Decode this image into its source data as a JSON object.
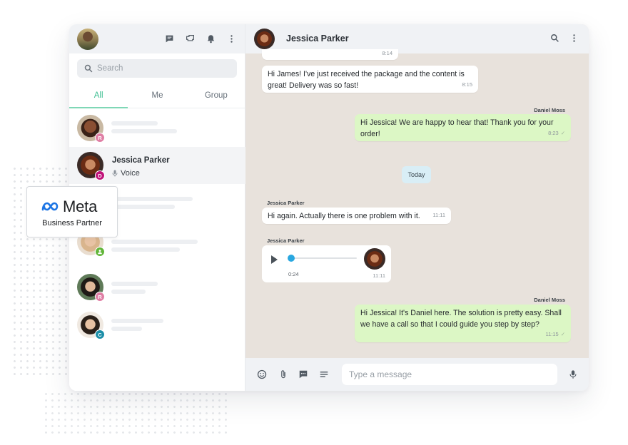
{
  "sidebar": {
    "header": {
      "icons": [
        "new-chat-icon",
        "broadcast-icon",
        "bell-icon",
        "more-vertical-icon"
      ]
    },
    "search": {
      "placeholder": "Search"
    },
    "tabs": [
      {
        "label": "All",
        "active": true
      },
      {
        "label": "Me"
      },
      {
        "label": "Group"
      }
    ],
    "chats": [
      {
        "badge": "R",
        "badge_color": "#e07fa5"
      },
      {
        "name": "Jessica Parker",
        "badge": "D",
        "badge_color": "#c0137a",
        "subtitle": "Voice",
        "selected": true
      },
      {
        "badge": ""
      },
      {
        "badge": "",
        "badge_color": "#62b63a",
        "badge_icon": "group-icon"
      },
      {
        "badge": "R",
        "badge_color": "#e07fa5"
      },
      {
        "badge": "C",
        "badge_color": "#1c8ea8"
      }
    ]
  },
  "conversation": {
    "contact_name": "Jessica Parker",
    "header_icons": [
      "search-icon",
      "more-vertical-icon"
    ],
    "messages": [
      {
        "direction": "in",
        "text": "",
        "time": "8:14"
      },
      {
        "direction": "in",
        "text": "Hi James! I've just received the package and the content is great! Delivery was so fast!",
        "time": "8:15"
      },
      {
        "direction": "out",
        "sender": "Daniel Moss",
        "text": "Hi Jessica! We are happy to hear that! Thank you for your order!",
        "time": "8:23"
      },
      {
        "direction": "in",
        "sender": "Jessica Parker",
        "text": "Hi again. Actually there is one problem with it.",
        "time": "11:11"
      },
      {
        "direction": "in",
        "sender": "Jessica Parker",
        "type": "voice",
        "duration": "0:24",
        "time": "11:11"
      },
      {
        "direction": "out",
        "sender": "Daniel Moss",
        "text": "Hi Jessica! It's Daniel here. The solution is pretty easy. Shall we have a call so that I could guide you step by step?",
        "time": "11:15"
      }
    ],
    "day_separator": "Today",
    "composer": {
      "placeholder": "Type a message",
      "icons": [
        "emoji-icon",
        "attach-icon",
        "quick-reply-icon",
        "template-icon",
        "microphone-icon"
      ]
    }
  },
  "meta_badge": {
    "logo_text": "Meta",
    "subtitle": "Business Partner"
  },
  "colors": {
    "accent": "#3fbf92",
    "outgoing_bubble": "#dcf7c5",
    "chat_background": "#e8e2dc",
    "voice_knob": "#29a7e0"
  }
}
